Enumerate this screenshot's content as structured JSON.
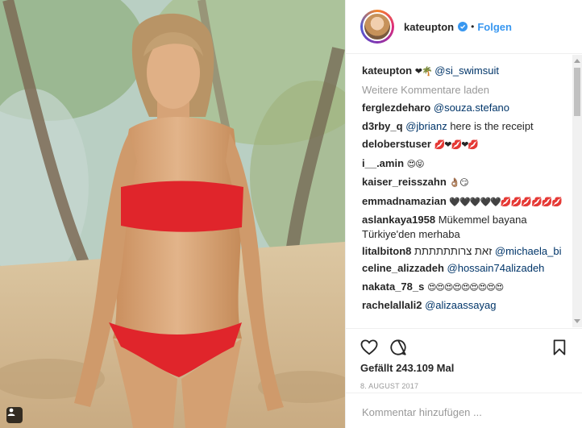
{
  "post": {
    "username": "kateupton",
    "follow_label": "Folgen",
    "dot": "•"
  },
  "caption": {
    "user": "kateupton",
    "emojis": "❤🌴",
    "mention": "@si_swimsuit"
  },
  "load_more": "Weitere Kommentare laden",
  "comments": [
    {
      "user": "ferglezdeharo",
      "text": "",
      "mention": "@souza.stefano"
    },
    {
      "user": "d3rby_q",
      "mention": "@jbrianz",
      "text": "here is the receipt"
    },
    {
      "user": "deloberstuser",
      "text": "💋❤💋❤💋"
    },
    {
      "user": "i__.amin",
      "text": "😍😝"
    },
    {
      "user": "kaiser_reisszahn",
      "text": "👌🏽😏"
    },
    {
      "user": "emmadnamazian",
      "text": "🖤🖤🖤🖤🖤💋💋💋💋💋💋"
    },
    {
      "user": "aslankaya1958",
      "text": "Mükemmel bayana Türkiye'den merhaba"
    },
    {
      "user": "litalbiton8",
      "text": "זאת צרותתתתתת",
      "mention": "@michaela_bi"
    },
    {
      "user": "celine_alizzadeh",
      "mention": "@hossain74alizadeh"
    },
    {
      "user": "nakata_78_s",
      "text": "😍😍😍😍😍😍😍😍😍"
    },
    {
      "user": "rachelallali2",
      "mention": "@alizaassayag"
    }
  ],
  "likes": "Gefällt 243.109 Mal",
  "date": "8. AUGUST 2017",
  "comment_input": {
    "placeholder": "Kommentar hinzufügen ..."
  },
  "colors": {
    "link": "#003569",
    "follow": "#3897f0",
    "muted": "#999999",
    "bikini": "#e0252b"
  },
  "icons": [
    "heart-icon",
    "comment-icon",
    "bookmark-icon",
    "verified-badge-icon",
    "user-tag-icon"
  ]
}
